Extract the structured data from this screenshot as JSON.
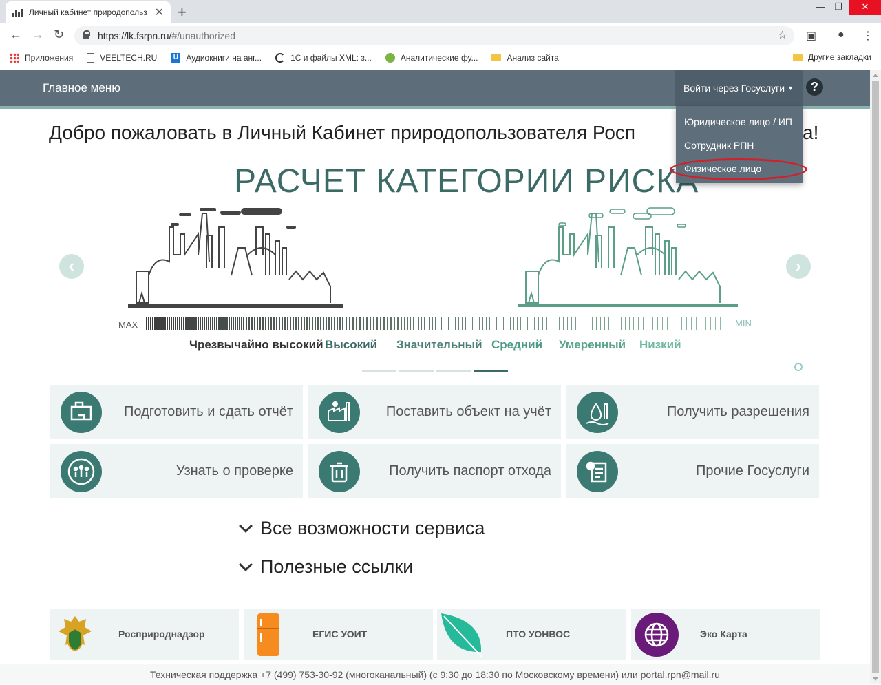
{
  "browser": {
    "tab_title": "Личный кабинет природопольз",
    "url_host": "https://lk.fsrpn.ru/",
    "url_path": "#/unauthorized",
    "bookmarks": [
      {
        "label": "Приложения",
        "icon": "apps-grid-icon"
      },
      {
        "label": "VEELTECH.RU",
        "icon": "page-icon"
      },
      {
        "label": "Аудиокниги на анг...",
        "icon": "u-icon"
      },
      {
        "label": "1С и файлы XML: з...",
        "icon": "refresh-icon"
      },
      {
        "label": "Аналитические фу...",
        "icon": "globe-icon"
      },
      {
        "label": "Анализ сайта",
        "icon": "folder-icon"
      }
    ],
    "other_bookmarks": "Другие закладки"
  },
  "header": {
    "main_menu": "Главное меню",
    "login_button": "Войти через Госуслуги",
    "help": "?"
  },
  "dropdown": {
    "items": [
      "Юридическое лицо / ИП",
      "Сотрудник РПН",
      "Физическое лицо"
    ],
    "highlighted_index": 2
  },
  "welcome": "Добро пожаловать в Личный Кабинет природопользователя Росп",
  "welcome_tail": "а!",
  "banner": {
    "title": "РАСЧЕТ КАТЕГОРИИ РИСКА",
    "scale_max": "MAX",
    "scale_min": "MIN",
    "risk_levels": [
      "Чрезвычайно высокий",
      "Высокий",
      "Значительный",
      "Средний",
      "Умеренный",
      "Низкий"
    ],
    "slides": 4,
    "active_slide": 3
  },
  "tiles": [
    "Подготовить и сдать отчёт",
    "Поставить объект на учёт",
    "Получить разрешения",
    "Узнать о проверке",
    "Получить паспорт отхода",
    "Прочие Госуслуги"
  ],
  "expanders": [
    "Все возможности сервиса",
    "Полезные ссылки"
  ],
  "links": [
    "Росприроднадзор",
    "ЕГИС УОИТ",
    "ПТО УОНВОС",
    "Эко Карта"
  ],
  "footer": {
    "text": "Техническая поддержка +7 (499) 753-30-92 (многоканальный) (с 9:30 до 18:30 по Московскому времени) или ",
    "email": "portal.rpn@mail.ru"
  },
  "colors": {
    "accent": "#3b7a72",
    "header_bg": "#5d6d7a",
    "highlight": "#d0202c"
  }
}
